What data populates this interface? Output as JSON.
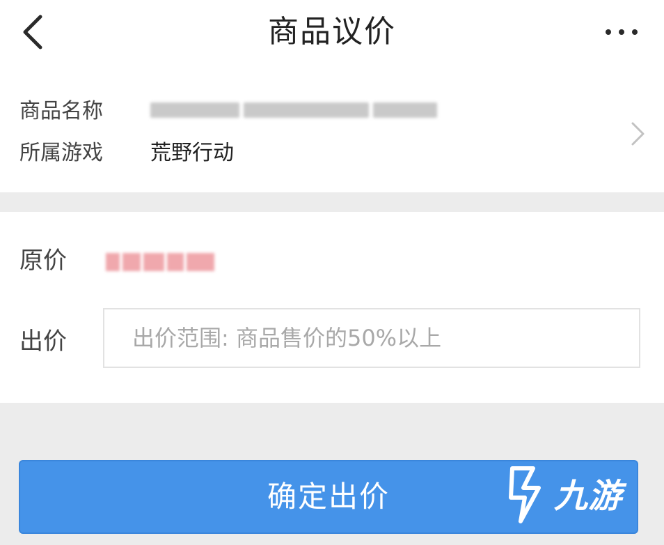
{
  "header": {
    "title": "商品议价",
    "back_icon": "chevron-left-icon",
    "more_icon": "more-dots-icon"
  },
  "goods": {
    "name_label": "商品名称",
    "game_label": "所属游戏",
    "game_value": "荒野行动",
    "arrow_icon": "chevron-right-icon"
  },
  "pricing": {
    "original_label": "原价",
    "bid_label": "出价",
    "bid_placeholder": "出价范围: 商品售价的50%以上",
    "bid_value": ""
  },
  "confirm_button": {
    "label": "确定出价",
    "color": "#4593e9"
  },
  "watermark": {
    "text": "九游",
    "icon": "jiuyou-logo-icon"
  }
}
